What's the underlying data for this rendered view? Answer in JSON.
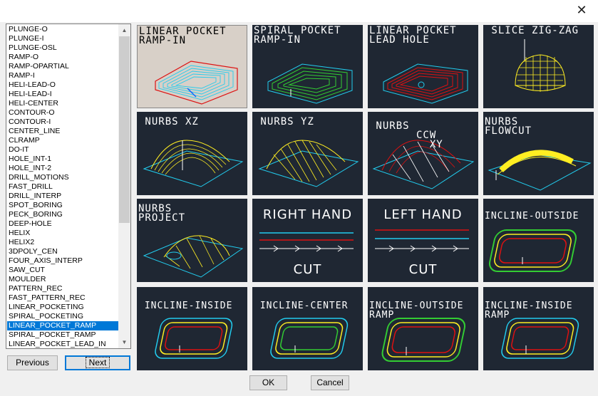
{
  "window": {
    "close_glyph": "✕"
  },
  "list": {
    "items": [
      "PLUNGE-O",
      "PLUNGE-I",
      "PLUNGE-OSL",
      "RAMP-O",
      "RAMP-OPARTIAL",
      "RAMP-I",
      "HELI-LEAD-O",
      "HELI-LEAD-I",
      "HELI-CENTER",
      "CONTOUR-O",
      "CONTOUR-I",
      "CENTER_LINE",
      "CLRAMP",
      "DO-IT",
      "HOLE_INT-1",
      "HOLE_INT-2",
      "DRILL_MOTIONS",
      "FAST_DRILL",
      "DRILL_INTERP",
      "SPOT_BORING",
      "PECK_BORING",
      "DEEP-HOLE",
      "HELIX",
      "HELIX2",
      "3DPOLY_CEN",
      "FOUR_AXIS_INTERP",
      "SAW_CUT",
      "MOULDER",
      "PATTERN_REC",
      "FAST_PATTERN_REC",
      "LINEAR_POCKETING",
      "SPIRAL_POCKETING",
      "LINEAR_POCKET_RAMP",
      "SPIRAL_POCKET_RAMP",
      "LINEAR_POCKET_LEAD_IN"
    ],
    "selected_item": "LINEAR_POCKET_RAMP"
  },
  "buttons": {
    "previous": "Previous",
    "next": "Next",
    "ok": "OK",
    "cancel": "Cancel"
  },
  "tiles": [
    {
      "label": "LINEAR POCKET\nRAMP-IN"
    },
    {
      "label": "SPIRAL POCKET\nRAMP-IN"
    },
    {
      "label": "LINEAR POCKET\nLEAD HOLE"
    },
    {
      "label": " SLICE ZIG-ZAG"
    },
    {
      "label": " NURBS XZ"
    },
    {
      "label": " NURBS YZ"
    },
    {
      "label": " NURBS\n       CCW\n         XY"
    },
    {
      "label": "NURBS\nFLOWCUT"
    },
    {
      "label": "NURBS\nPROJECT"
    },
    {
      "top": "RIGHT HAND",
      "bottom": "CUT"
    },
    {
      "top": "LEFT HAND",
      "bottom": "CUT"
    },
    {
      "label": "INCLINE-OUTSIDE"
    },
    {
      "label": " INCLINE-INSIDE"
    },
    {
      "label": " INCLINE-CENTER"
    },
    {
      "label": "INCLINE-OUTSIDE\nRAMP"
    },
    {
      "label": "INCLINE-INSIDE\nRAMP"
    }
  ],
  "colors": {
    "selection": "#0078d7",
    "tile_bg": "#1f2733",
    "selected_tile_bg": "#d8d0c8"
  }
}
